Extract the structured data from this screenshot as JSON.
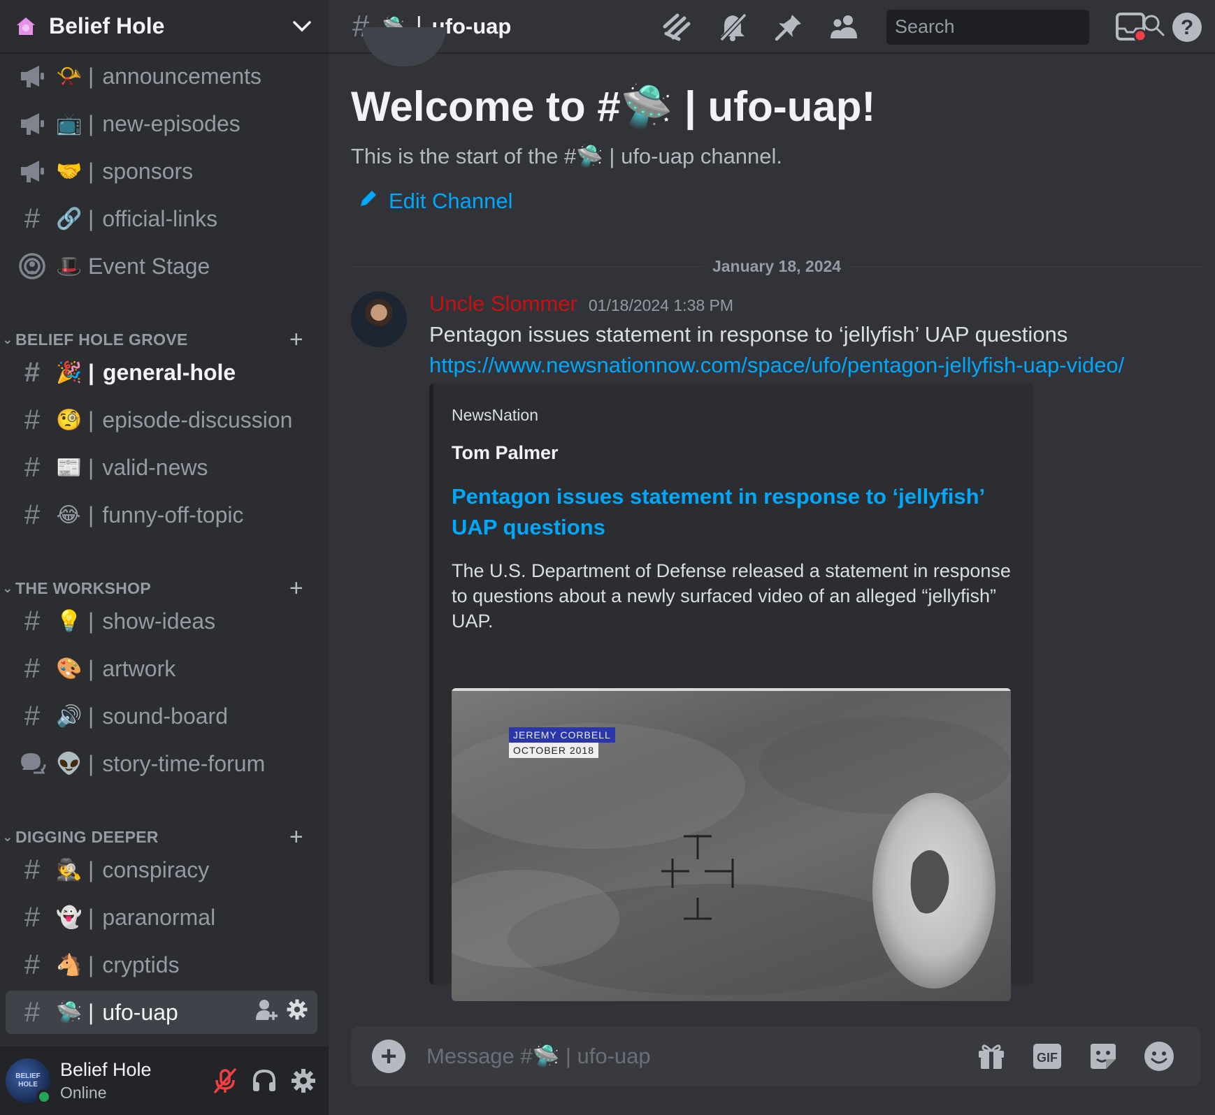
{
  "server": {
    "name": "Belief Hole"
  },
  "channels_top": [
    {
      "type": "announcement",
      "emoji": "📯",
      "label": "announcements"
    },
    {
      "type": "announcement",
      "emoji": "📺",
      "label": "new-episodes"
    },
    {
      "type": "announcement",
      "emoji": "🤝",
      "label": "sponsors"
    },
    {
      "type": "text",
      "emoji": "🔗",
      "label": "official-links"
    },
    {
      "type": "stage",
      "emoji": "🎩",
      "label": "Event Stage"
    }
  ],
  "categories": [
    {
      "name": "BELIEF HOLE GROVE",
      "channels": [
        {
          "type": "text",
          "emoji": "🎉",
          "label": "general-hole",
          "unread": true
        },
        {
          "type": "text",
          "emoji": "🧐",
          "label": "episode-discussion"
        },
        {
          "type": "text",
          "emoji": "📰",
          "label": "valid-news"
        },
        {
          "type": "text",
          "emoji": "😂",
          "label": "funny-off-topic"
        }
      ]
    },
    {
      "name": "THE WORKSHOP",
      "channels": [
        {
          "type": "text",
          "emoji": "💡",
          "label": "show-ideas"
        },
        {
          "type": "text",
          "emoji": "🎨",
          "label": "artwork"
        },
        {
          "type": "text",
          "emoji": "🔊",
          "label": "sound-board"
        },
        {
          "type": "forum",
          "emoji": "👽",
          "label": "story-time-forum"
        }
      ]
    },
    {
      "name": "DIGGING DEEPER",
      "channels": [
        {
          "type": "text",
          "emoji": "🕵️",
          "label": "conspiracy"
        },
        {
          "type": "text",
          "emoji": "👻",
          "label": "paranormal"
        },
        {
          "type": "text",
          "emoji": "🐴",
          "label": "cryptids"
        },
        {
          "type": "text",
          "emoji": "🛸",
          "label": "ufo-uap",
          "selected": true
        }
      ]
    }
  ],
  "user": {
    "name": "Belief Hole",
    "status": "Online",
    "avatar_text": "BELIEF HOLE"
  },
  "topbar": {
    "channel_emoji": "🛸",
    "channel_name": "ufo-uap",
    "search_placeholder": "Search"
  },
  "welcome": {
    "title": "Welcome to #🛸 | ufo-uap!",
    "subtitle": "This is the start of the #🛸 | ufo-uap channel.",
    "edit_label": "Edit Channel"
  },
  "date_divider": "January 18, 2024",
  "message": {
    "author": "Uncle Slommer",
    "author_color": "#c81010",
    "timestamp": "01/18/2024 1:38 PM",
    "text": "Pentagon issues statement in response to ‘jellyfish’ UAP questions",
    "link": "https://www.newsnationnow.com/space/ufo/pentagon-jellyfish-uap-video/",
    "embed": {
      "provider": "NewsNation",
      "author": "Tom Palmer",
      "title": "Pentagon issues statement in response to ‘jellyfish’ UAP questions",
      "description": "The U.S. Department of Defense released a statement in response to questions about a newly surfaced video of an alleged “jellyfish” UAP.",
      "image_caption_name": "JEREMY CORBELL",
      "image_caption_date": "OCTOBER 2018"
    }
  },
  "composer": {
    "placeholder": "Message #🛸 | ufo-uap"
  },
  "colors": {
    "link": "#00a8fc",
    "online": "#23a55a",
    "muted_red": "#f23f43"
  }
}
